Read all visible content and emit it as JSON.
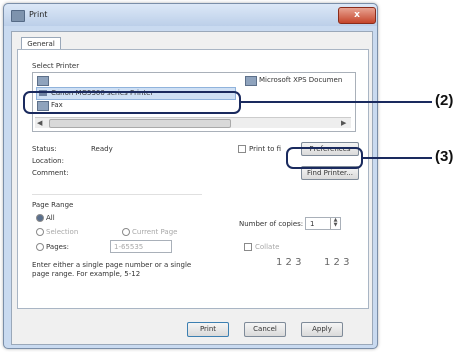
{
  "window": {
    "title": "Print",
    "close_glyph": "x"
  },
  "tabs": [
    {
      "label": "General"
    }
  ],
  "select_printer": {
    "heading": "Select Printer",
    "items": [
      {
        "label": "Microsoft XPS Documen"
      },
      {
        "label": "Canon MG5300 series Printer"
      },
      {
        "label": "Fax"
      }
    ]
  },
  "status": {
    "status_label": "Status:",
    "status_value": "Ready",
    "location_label": "Location:",
    "comment_label": "Comment:",
    "print_to_file_label": "Print to fi",
    "preferences_label": "Preferences",
    "find_printer_label": "Find Printer..."
  },
  "page_range": {
    "heading": "Page Range",
    "all_label": "All",
    "selection_label": "Selection",
    "current_page_label": "Current Page",
    "pages_label": "Pages:",
    "pages_value": "1-65535",
    "hint_line1": "Enter either a single page number or a single",
    "hint_line2": "page range.  For example, 5-12"
  },
  "copies": {
    "label": "Number of copies:",
    "value": "1",
    "collate_label": "Collate",
    "collate_sets": [
      "1 2 3",
      "1 2 3"
    ]
  },
  "footer": {
    "print_label": "Print",
    "cancel_label": "Cancel",
    "apply_label": "Apply"
  },
  "callouts": {
    "c2": "(2)",
    "c3": "(3)"
  }
}
